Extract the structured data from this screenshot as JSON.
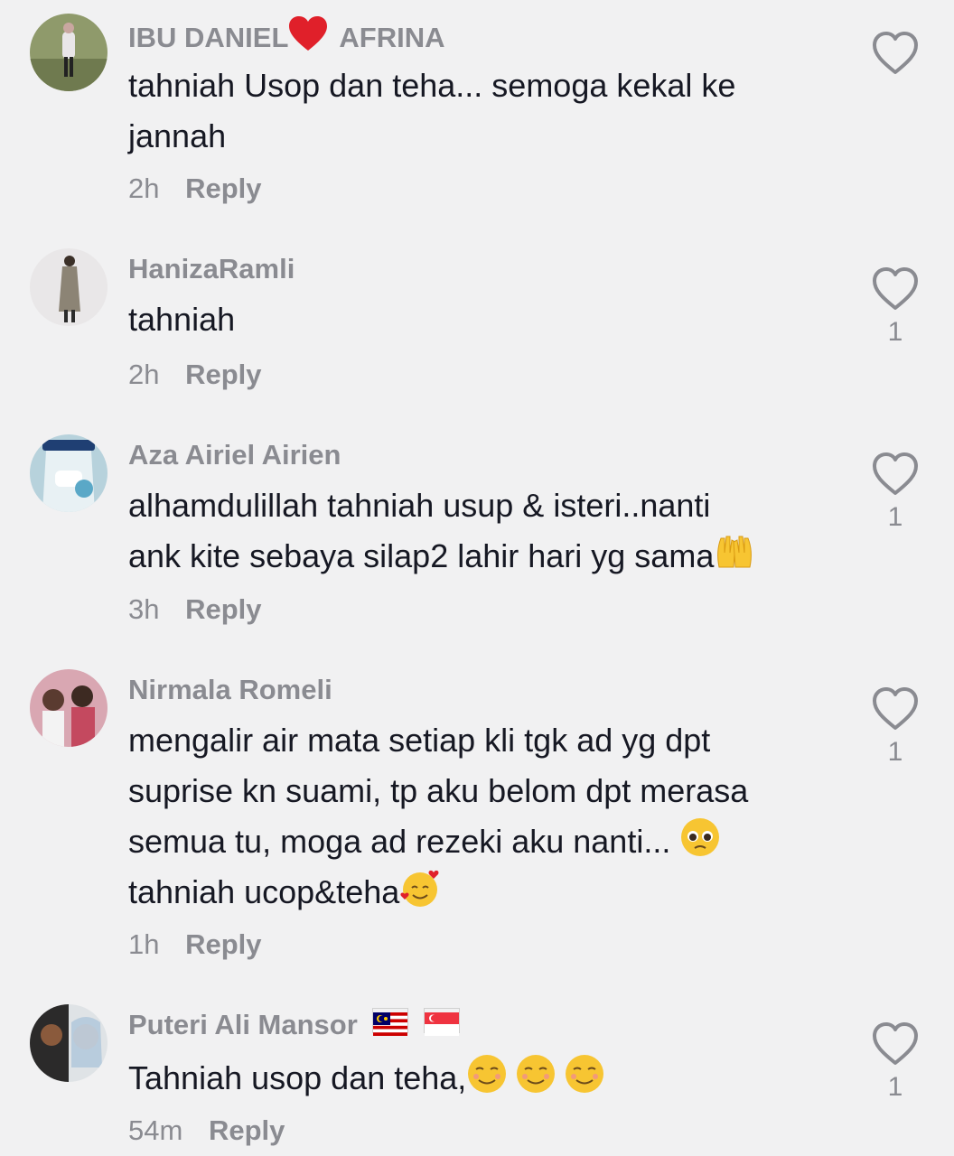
{
  "comments": [
    {
      "username_part1": "IBU DANIEL",
      "username_heart": "❤",
      "username_part2": "AFRINA",
      "text_line1": "tahniah Usop dan teha... semoga kekal ke",
      "text_line2": "jannah",
      "time": "2h",
      "reply": "Reply",
      "likes": ""
    },
    {
      "username": "HanizaRamli",
      "text_line1": "tahniah",
      "time": "2h",
      "reply": "Reply",
      "likes": "1"
    },
    {
      "username": "Aza Airiel Airien",
      "text_line1": "alhamdulillah tahniah usup & isteri..nanti",
      "text_line2": "ank kite sebaya silap2 lahir hari yg sama",
      "text_line2_emoji": "🤲",
      "time": "3h",
      "reply": "Reply",
      "likes": "1"
    },
    {
      "username": "Nirmala Romeli",
      "text_line1": "mengalir air mata setiap kli tgk ad yg dpt",
      "text_line2": "suprise kn suami, tp aku belom dpt merasa",
      "text_line3": "semua tu, moga ad rezeki aku nanti...",
      "text_line3_emoji": "🥺",
      "text_line4": "tahniah ucop&teha",
      "text_line4_emoji": "🥰",
      "time": "1h",
      "reply": "Reply",
      "likes": "1"
    },
    {
      "username": "Puteri Ali Mansor",
      "username_flags": [
        "malaysia-flag",
        "singapore-flag"
      ],
      "text_line1": "Tahniah usop dan teha,",
      "text_line1_emoji": "☺",
      "time": "54m",
      "reply": "Reply",
      "likes": "1"
    }
  ],
  "colors": {
    "background": "#f1f1f2",
    "username": "#8a8b91",
    "text": "#161823",
    "heart_red": "#e0202a",
    "like_outline": "#8a8b91"
  }
}
